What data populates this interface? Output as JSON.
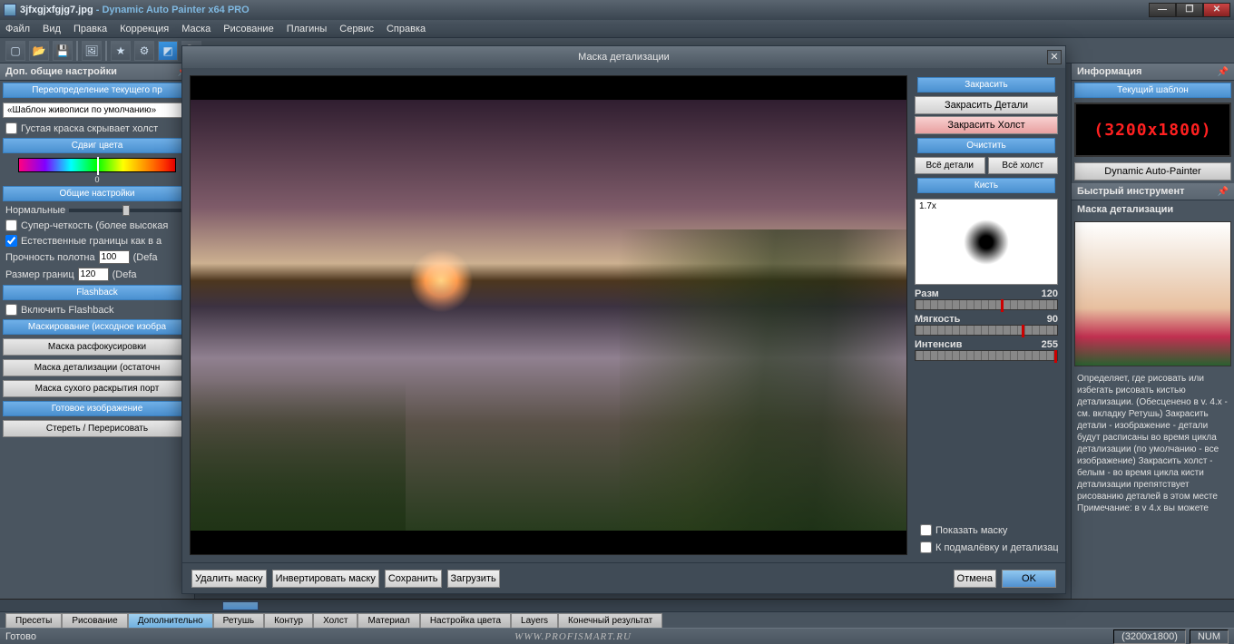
{
  "titlebar": {
    "filename": "3jfxgjxfgjg7.jpg",
    "appname": "Dynamic Auto Painter x64 PRO"
  },
  "menubar": [
    "Файл",
    "Вид",
    "Правка",
    "Коррекция",
    "Маска",
    "Рисование",
    "Плагины",
    "Сервис",
    "Справка"
  ],
  "toolbar_icons": [
    "new",
    "open",
    "save",
    "image",
    "star",
    "settings",
    "mask",
    "zoom"
  ],
  "left": {
    "title": "Доп. общие настройки",
    "cat_override": "Переопределение текущего пр",
    "template_default": "«Шаблон живописи по умолчанию»",
    "thick_paint": "Густая краска скрывает холст",
    "color_shift": "Сдвиг цвета",
    "color_val": "0",
    "general": "Общие настройки",
    "normal": "Нормальные",
    "super_clear": "Супер-четкость (более высокая",
    "natural": "Естественные границы как в а",
    "strength": "Прочность полотна",
    "strength_val": "100",
    "strength_def": "(Defa",
    "border": "Размер границ",
    "border_val": "120",
    "border_def": "(Defa",
    "flashback_h": "Flashback",
    "flashback": "Включить Flashback",
    "masking_h": "Маскирование (исходное изобра",
    "mask_defocus": "Маска расфокусировки",
    "mask_detail": "Маска детализации (остаточн",
    "mask_dry": "Маска сухого раскрытия порт",
    "final_h": "Готовое изображение",
    "erase": "Стереть / Перерисовать"
  },
  "right": {
    "info_h": "Информация",
    "template_h": "Текущий шаблон",
    "template_dim": "(3200x1800)",
    "app_btn": "Dynamic Auto-Painter",
    "quick_h": "Быстрый инструмент",
    "title": "Маска детализации",
    "text": "Определяет, где рисовать или избегать рисовать кистью детализации. (Обесценено в v. 4.x - см. вкладку Ретушь)\n\nЗакрасить детали - изображение - детали будут расписаны во время цикла детализации (по умолчанию - все изображение)\nЗакрасить холст - белым - во время цикла кисти детализации препятствует рисованию деталей в этом месте\n\nПримечание: в v 4.x вы можете"
  },
  "dialog": {
    "title": "Маска детализации",
    "paint_h": "Закрасить",
    "paint_detail": "Закрасить Детали",
    "paint_canvas": "Закрасить Холст",
    "clear_h": "Очистить",
    "all_detail": "Всё детали",
    "all_canvas": "Всё холст",
    "brush_h": "Кисть",
    "brush_size": "1.7x",
    "s1_lbl": "Разм",
    "s1_val": "120",
    "s2_lbl": "Мягкость",
    "s2_val": "90",
    "s3_lbl": "Интенсив",
    "s3_val": "255",
    "show_mask": "Показать маску",
    "to_under": "К подмалёвку и детализации",
    "footer": {
      "delete": "Удалить маску",
      "invert": "Инвертировать маску",
      "save": "Сохранить",
      "load": "Загрузить",
      "cancel": "Отмена",
      "ok": "OK"
    }
  },
  "tabs": [
    "Пресеты",
    "Рисование",
    "Дополнительно",
    "Ретушь",
    "Контур",
    "Холст",
    "Материал",
    "Настройка цвета",
    "Layers",
    "Конечный результат"
  ],
  "tabs_active_index": 2,
  "status": {
    "ready": "Готово",
    "site": "WWW.PROFISMART.RU",
    "dim": "(3200x1800)",
    "num": "NUM"
  }
}
